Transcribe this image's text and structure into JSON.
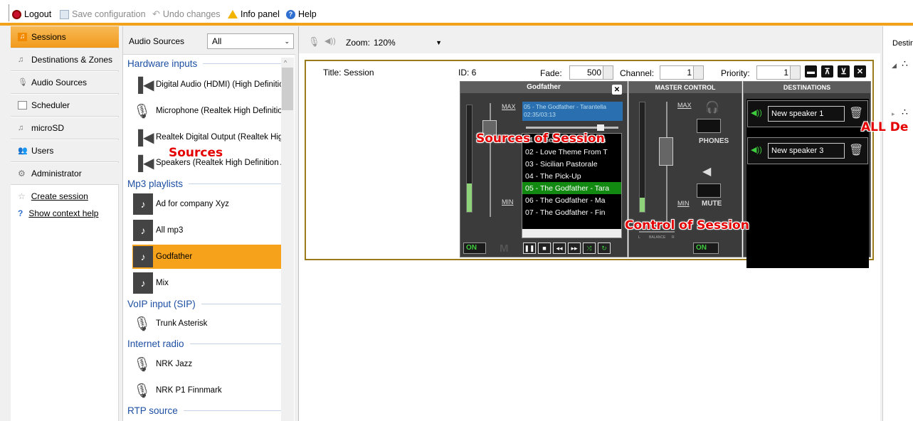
{
  "toolbar": {
    "logout": "Logout",
    "save": "Save configuration",
    "undo": "Undo changes",
    "info": "Info panel",
    "help": "Help"
  },
  "nav": {
    "items": [
      {
        "label": "Sessions"
      },
      {
        "label": "Destinations & Zones"
      },
      {
        "label": "Audio Sources"
      },
      {
        "label": "Scheduler"
      },
      {
        "label": "microSD"
      },
      {
        "label": "Users"
      },
      {
        "label": "Administrator"
      }
    ],
    "create_session": "Create session",
    "context_help": "Show context help"
  },
  "sources": {
    "header_label": "Audio Sources",
    "filter_value": "All",
    "hardware_title": "Hardware inputs",
    "hardware": [
      "Digital Audio (HDMI) (High Definitic",
      "Microphone (Realtek High Definitio",
      "Realtek Digital Output (Realtek Hig",
      "Speakers (Realtek High Definition A"
    ],
    "mp3_title": "Mp3 playlists",
    "mp3": [
      "Ad for company Xyz",
      "All mp3",
      "Godfather",
      "Mix"
    ],
    "voip_title": "VoIP input (SIP)",
    "voip": [
      "Trunk Asterisk"
    ],
    "radio_title": "Internet radio",
    "radio": [
      "NRK Jazz",
      "NRK P1 Finnmark"
    ],
    "rtp_title": "RTP source",
    "annotation": "Sources"
  },
  "center": {
    "zoom_label": "Zoom:",
    "zoom_value": "120%"
  },
  "session": {
    "title": "Title: Session",
    "id": "ID:  6",
    "fade_label": "Fade:",
    "fade_value": "500",
    "channel_label": "Channel:",
    "channel_value": "1",
    "priority_label": "Priority:",
    "priority_value": "1",
    "player_title": "Godfather",
    "now_playing": "05 - The Godfather - Tarantella",
    "now_time": "02:35/03:13",
    "max_label": "MAX",
    "min_label": "MIN",
    "tracks": [
      "01 - The Godfather - Wa",
      "02 - Love Theme From T",
      "03 - Sicilian Pastorale",
      "04 - The Pick-Up",
      "05 - The Godfather - Tara",
      "06 - The Godfather - Ma",
      "07 - The Godfather - Fin"
    ],
    "on_label": "ON",
    "m_label": "M",
    "master_title": "MASTER CONTROL",
    "phones_label": "PHONES",
    "mute_label": "MUTE",
    "balance_label": "BALANCE",
    "bal_l": "L",
    "bal_r": "R",
    "dest_title": "DESTINATIONS",
    "destinations": [
      "New speaker 1",
      "New speaker 3"
    ],
    "annotation_sources": "Sources of Session",
    "annotation_control": "Control of Session"
  },
  "right": {
    "header": "Destir",
    "annotation": "ALL De"
  }
}
